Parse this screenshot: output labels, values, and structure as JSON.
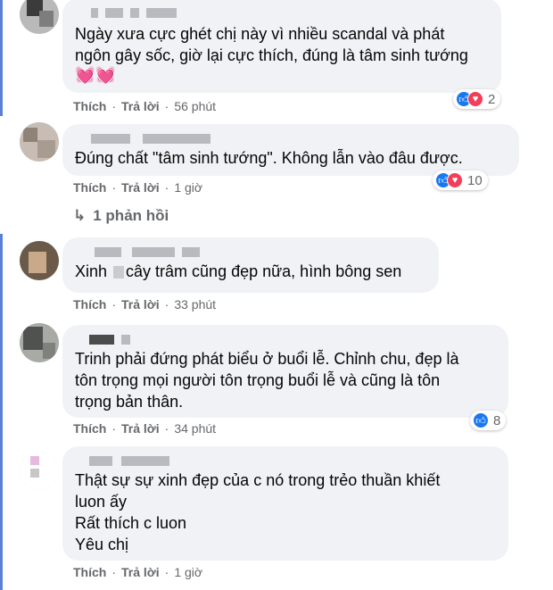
{
  "comments": [
    {
      "text": "Ngày xưa cực ghét chị này vì nhiều scandal và phát\nngôn gây sốc, giờ lại cực thích, đúng là tâm sinh tướng",
      "emoji": "💓💓",
      "like_label": "Thích",
      "reply_label": "Trả lời",
      "time": "56 phút",
      "reaction_count": "2",
      "reactions": [
        "like-icon",
        "love-icon"
      ]
    },
    {
      "text": "Đúng chất \"tâm sinh tướng\". Không lẫn vào đâu được.",
      "like_label": "Thích",
      "reply_label": "Trả lời",
      "time": "1 giờ",
      "reaction_count": "10",
      "reactions": [
        "like-icon",
        "love-icon"
      ]
    },
    {
      "text_before": "Xinh ",
      "text_after": "cây trâm cũng đẹp nữa, hình bông sen",
      "like_label": "Thích",
      "reply_label": "Trả lời",
      "time": "33 phút"
    },
    {
      "text": "Trinh phải đứng phát biểu ở buổi lễ. Chỉnh chu, đẹp là\ntôn trọng mọi người tôn trọng buổi lễ và cũng là tôn\ntrọng bản thân.",
      "like_label": "Thích",
      "reply_label": "Trả lời",
      "time": "34 phút",
      "reaction_count": "8",
      "reactions": [
        "like-icon"
      ]
    },
    {
      "text": "Thật sự sự xinh đẹp của c nó trong trẻo thuần khiết\nluon ấy\nRất thích c luon\nYêu chị",
      "like_label": "Thích",
      "reply_label": "Trả lời",
      "time": "1 giờ"
    }
  ],
  "replies_link": {
    "arrow": "↳",
    "label": "1 phản hồi"
  },
  "colors": {
    "bubble": "#f0f2f5",
    "meta": "#65676b",
    "like": "#1877f2",
    "love": "#f33e58",
    "thread": "#5b7fd6"
  }
}
